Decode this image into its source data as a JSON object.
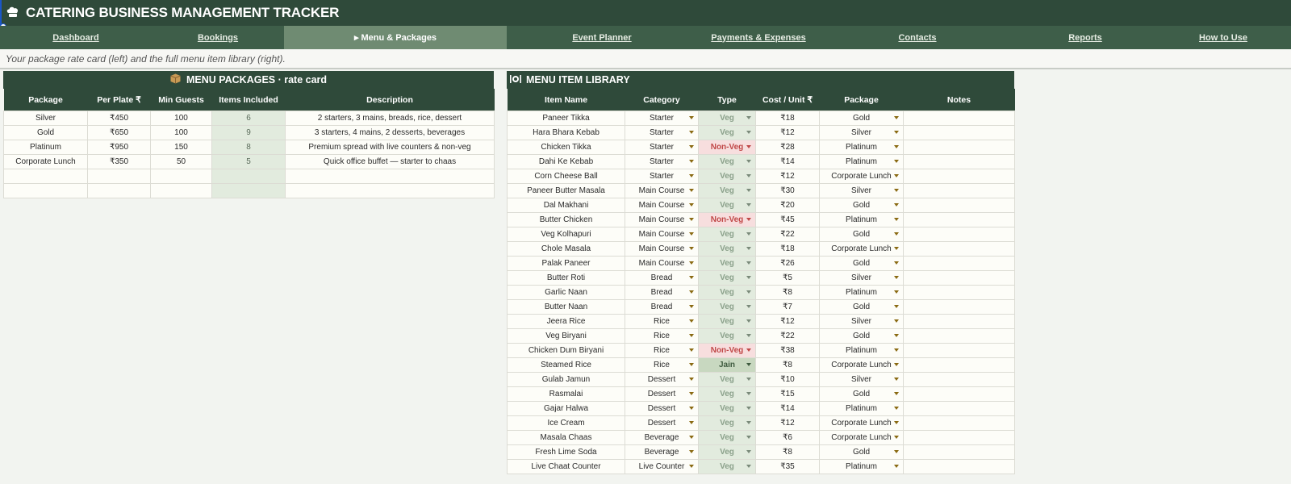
{
  "app": {
    "logo_icon": "chef-hat-icon",
    "title": "CATERING BUSINESS MANAGEMENT TRACKER"
  },
  "nav": {
    "tabs": [
      {
        "label": "Dashboard"
      },
      {
        "label": "Bookings"
      },
      {
        "label": "▸ Menu & Packages"
      },
      {
        "label": "Event Planner"
      },
      {
        "label": "Payments & Expenses"
      },
      {
        "label": "Contacts"
      },
      {
        "label": "Reports"
      },
      {
        "label": "How to Use"
      }
    ],
    "active": "Menu & Packages"
  },
  "subtitle": "Your package rate card (left) and the full menu item library (right).",
  "packages": {
    "icon": "package-icon",
    "heading": "MENU PACKAGES  ·  rate card",
    "columns": [
      "Package",
      "Per Plate ₹",
      "Min Guests",
      "Items Included",
      "Description"
    ],
    "rows": [
      [
        "Silver",
        "₹450",
        "100",
        "6",
        "2 starters, 3 mains, breads, rice, dessert"
      ],
      [
        "Gold",
        "₹650",
        "100",
        "9",
        "3 starters, 4 mains, 2 desserts, beverages"
      ],
      [
        "Platinum",
        "₹950",
        "150",
        "8",
        "Premium spread with live counters & non-veg"
      ],
      [
        "Corporate Lunch",
        "₹350",
        "50",
        "5",
        "Quick office buffet — starter to chaas"
      ],
      [
        "",
        "",
        "",
        "",
        ""
      ],
      [
        "",
        "",
        "",
        "",
        ""
      ]
    ]
  },
  "library": {
    "icon": "dish-icon",
    "heading": "MENU ITEM LIBRARY",
    "columns": [
      "Item Name",
      "Category",
      "Type",
      "Cost / Unit ₹",
      "Package",
      "Notes"
    ],
    "rows": [
      [
        "Paneer Tikka",
        "Starter",
        "Veg",
        "₹18",
        "Gold",
        ""
      ],
      [
        "Hara Bhara Kebab",
        "Starter",
        "Veg",
        "₹12",
        "Silver",
        ""
      ],
      [
        "Chicken Tikka",
        "Starter",
        "Non-Veg",
        "₹28",
        "Platinum",
        ""
      ],
      [
        "Dahi Ke Kebab",
        "Starter",
        "Veg",
        "₹14",
        "Platinum",
        ""
      ],
      [
        "Corn Cheese Ball",
        "Starter",
        "Veg",
        "₹12",
        "Corporate Lunch",
        ""
      ],
      [
        "Paneer Butter Masala",
        "Main Course",
        "Veg",
        "₹30",
        "Silver",
        ""
      ],
      [
        "Dal Makhani",
        "Main Course",
        "Veg",
        "₹20",
        "Gold",
        ""
      ],
      [
        "Butter Chicken",
        "Main Course",
        "Non-Veg",
        "₹45",
        "Platinum",
        ""
      ],
      [
        "Veg Kolhapuri",
        "Main Course",
        "Veg",
        "₹22",
        "Gold",
        ""
      ],
      [
        "Chole Masala",
        "Main Course",
        "Veg",
        "₹18",
        "Corporate Lunch",
        ""
      ],
      [
        "Palak Paneer",
        "Main Course",
        "Veg",
        "₹26",
        "Gold",
        ""
      ],
      [
        "Butter Roti",
        "Bread",
        "Veg",
        "₹5",
        "Silver",
        ""
      ],
      [
        "Garlic Naan",
        "Bread",
        "Veg",
        "₹8",
        "Platinum",
        ""
      ],
      [
        "Butter Naan",
        "Bread",
        "Veg",
        "₹7",
        "Gold",
        ""
      ],
      [
        "Jeera Rice",
        "Rice",
        "Veg",
        "₹12",
        "Silver",
        ""
      ],
      [
        "Veg Biryani",
        "Rice",
        "Veg",
        "₹22",
        "Gold",
        ""
      ],
      [
        "Chicken Dum Biryani",
        "Rice",
        "Non-Veg",
        "₹38",
        "Platinum",
        ""
      ],
      [
        "Steamed Rice",
        "Rice",
        "Jain",
        "₹8",
        "Corporate Lunch",
        ""
      ],
      [
        "Gulab Jamun",
        "Dessert",
        "Veg",
        "₹10",
        "Silver",
        ""
      ],
      [
        "Rasmalai",
        "Dessert",
        "Veg",
        "₹15",
        "Gold",
        ""
      ],
      [
        "Gajar Halwa",
        "Dessert",
        "Veg",
        "₹14",
        "Platinum",
        ""
      ],
      [
        "Ice Cream",
        "Dessert",
        "Veg",
        "₹12",
        "Corporate Lunch",
        ""
      ],
      [
        "Masala Chaas",
        "Beverage",
        "Veg",
        "₹6",
        "Corporate Lunch",
        ""
      ],
      [
        "Fresh Lime Soda",
        "Beverage",
        "Veg",
        "₹8",
        "Gold",
        ""
      ],
      [
        "Live Chaat Counter",
        "Live Counter",
        "Veg",
        "₹35",
        "Platinum",
        ""
      ]
    ]
  },
  "colors": {
    "header": "#2f4a3a",
    "nav": "#3e5e49",
    "active_tab": "#6f8b72",
    "veg": "#e2ebde",
    "nonveg": "#f7dede",
    "jain": "#c8d8c0"
  }
}
